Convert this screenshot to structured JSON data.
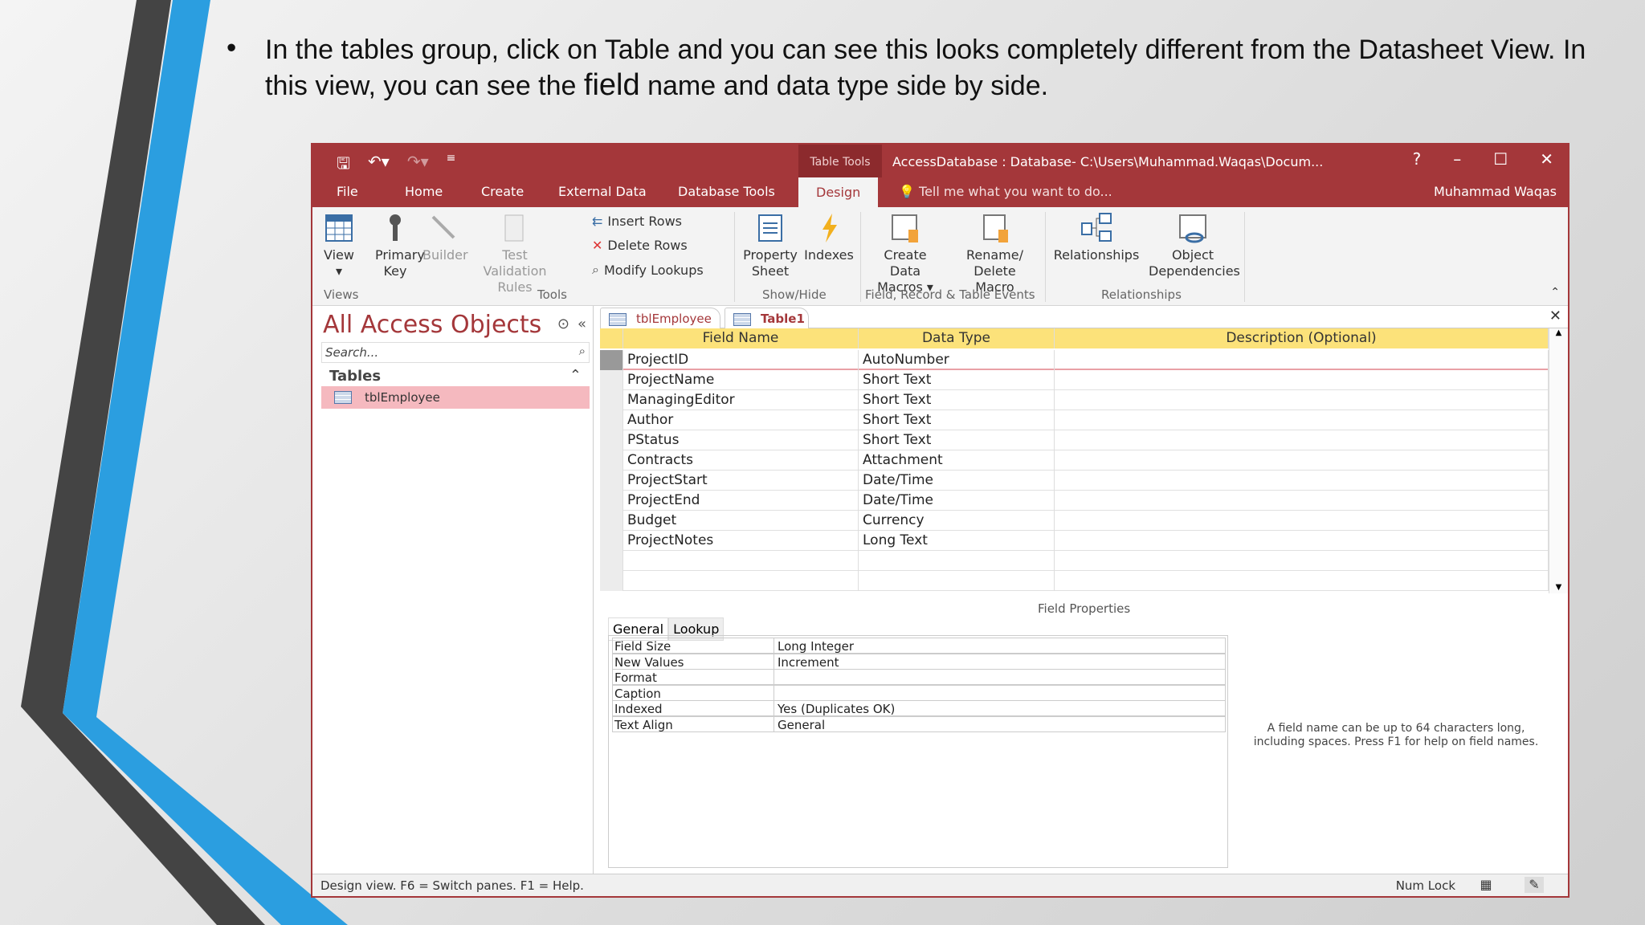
{
  "slide": {
    "bullet": "•",
    "text_a": "In the tables group, click on Table and you can see this looks completely different from the Datasheet View. In this view, you can see the ",
    "text_field": "field",
    "text_b": " name and data type side by side."
  },
  "titlebar": {
    "context_tab": "Table Tools",
    "title": "AccessDatabase : Database- C:\\Users\\Muhammad.Waqas\\Docum...",
    "help": "?",
    "minimize": "–",
    "maximize": "☐",
    "close": "✕",
    "qat": [
      "save-icon",
      "undo-icon",
      "redo-icon",
      "customize-icon"
    ]
  },
  "tabs": [
    "File",
    "Home",
    "Create",
    "External Data",
    "Database Tools",
    "Design"
  ],
  "tell_me": "Tell me what you want to do...",
  "user": "Muhammad Waqas",
  "ribbon": {
    "view": "View",
    "primary_key": "Primary Key",
    "builder": "Builder",
    "test_validation": "Test Validation Rules",
    "insert_rows": "Insert Rows",
    "delete_rows": "Delete Rows",
    "modify_lookups": "Modify Lookups",
    "property_sheet": "Property Sheet",
    "indexes": "Indexes",
    "create_data_macros": "Create Data Macros ▾",
    "rename_delete_macro": "Rename/ Delete Macro",
    "relationships": "Relationships",
    "object_dependencies": "Object Dependencies",
    "groups": [
      "Views",
      "Tools",
      "Show/Hide",
      "Field, Record & Table Events",
      "Relationships"
    ]
  },
  "nav": {
    "title": "All Access Objects",
    "search_placeholder": "Search...",
    "group": "Tables",
    "items": [
      "tblEmployee"
    ]
  },
  "doc_tabs": [
    "tblEmployee",
    "Table1"
  ],
  "grid": {
    "headers": [
      "Field Name",
      "Data Type",
      "Description (Optional)"
    ],
    "rows": [
      [
        "ProjectID",
        "AutoNumber"
      ],
      [
        "ProjectName",
        "Short Text"
      ],
      [
        "ManagingEditor",
        "Short Text"
      ],
      [
        "Author",
        "Short Text"
      ],
      [
        "PStatus",
        "Short Text"
      ],
      [
        "Contracts",
        "Attachment"
      ],
      [
        "ProjectStart",
        "Date/Time"
      ],
      [
        "ProjectEnd",
        "Date/Time"
      ],
      [
        "Budget",
        "Currency"
      ],
      [
        "ProjectNotes",
        "Long Text"
      ]
    ]
  },
  "field_properties": {
    "label": "Field Properties",
    "tabs": [
      "General",
      "Lookup"
    ],
    "rows": [
      [
        "Field Size",
        "Long Integer"
      ],
      [
        "New Values",
        "Increment"
      ],
      [
        "Format",
        ""
      ],
      [
        "Caption",
        ""
      ],
      [
        "Indexed",
        "Yes (Duplicates OK)"
      ],
      [
        "Text Align",
        "General"
      ]
    ],
    "help": "A field name can be up to 64 characters long, including spaces. Press F1 for help on field names."
  },
  "status": {
    "text": "Design view.  F6 = Switch panes.  F1 = Help.",
    "num_lock": "Num Lock"
  },
  "colors": {
    "accent": "#a4373a",
    "header": "#fce27a",
    "selected": "#f5b9bf"
  }
}
